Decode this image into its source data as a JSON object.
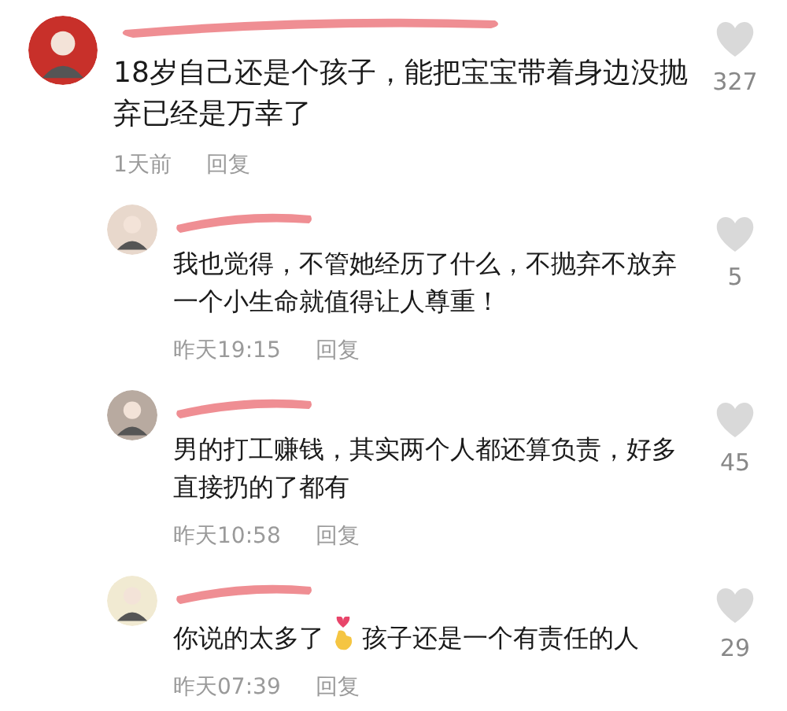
{
  "comments": [
    {
      "kind": "top",
      "color": "#c8302a",
      "text": "18岁自己还是个孩子，能把宝宝带着身边没抛弃已经是万幸了",
      "time": "1天前",
      "reply": "回复",
      "likes": "327"
    },
    {
      "kind": "reply",
      "color": "#e8d8cc",
      "text": "我也觉得，不管她经历了什么，不抛弃不放弃一个小生命就值得让人尊重！",
      "time": "昨天19:15",
      "reply": "回复",
      "likes": "5"
    },
    {
      "kind": "reply",
      "color": "#b8aaa0",
      "text": "男的打工赚钱，其实两个人都还算负责，好多直接扔的了都有",
      "time": "昨天10:58",
      "reply": "回复",
      "likes": "45"
    },
    {
      "kind": "reply",
      "color": "#f1ead2",
      "text": "你说的太多了",
      "text_2": "孩子还是一个有责任的人",
      "time": "昨天07:39",
      "reply": "回复",
      "likes": "29"
    }
  ]
}
